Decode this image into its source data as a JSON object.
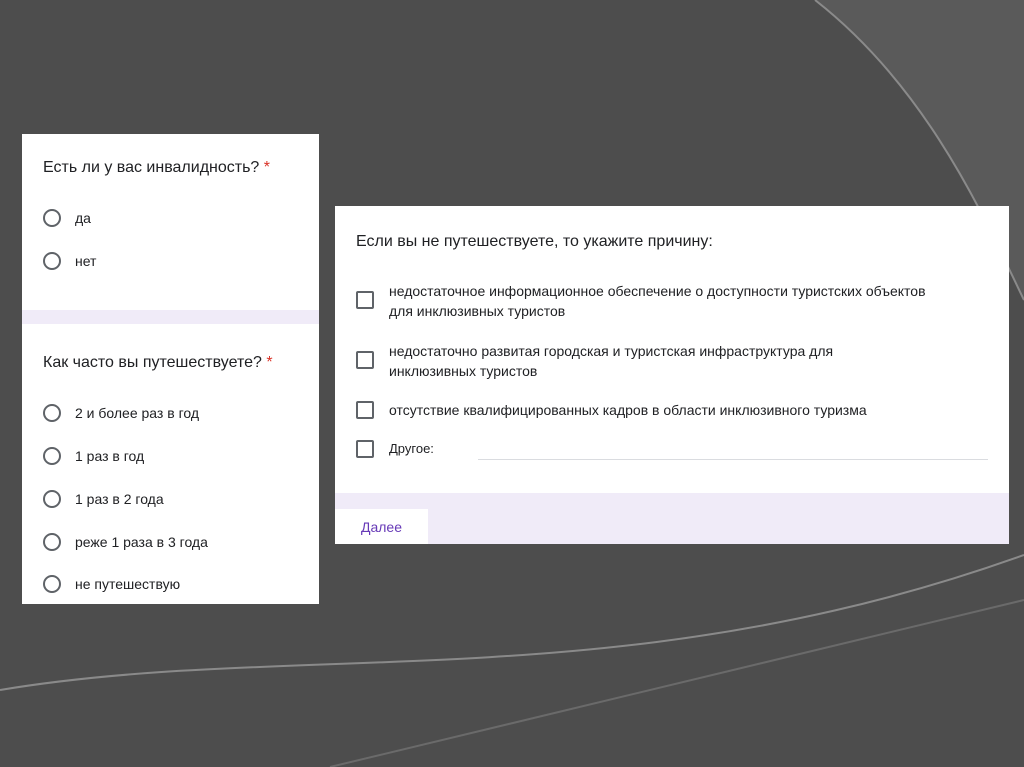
{
  "left_form": {
    "q1": {
      "title": "Есть ли у вас инвалидность?",
      "required_mark": "*",
      "options": [
        "да",
        "нет"
      ]
    },
    "q2": {
      "title": "Как часто вы путешествуете?",
      "required_mark": "*",
      "options": [
        "2 и более раз в год",
        "1 раз в год",
        "1 раз в 2 года",
        "реже 1 раза в 3 года",
        "не путешествую"
      ]
    }
  },
  "right_form": {
    "question": "Если вы не путешествуете, то укажите причину:",
    "options": [
      "недостаточное информационное обеспечение о доступности туристских объектов для инклюзивных туристов",
      "недостаточно развитая городская и туристская инфраструктура для инклюзивных туристов",
      "отсутствие квалифицированных кадров в области инклюзивного туризма"
    ],
    "other_label": "Другое:",
    "next_button": "Далее"
  },
  "colors": {
    "accent": "#673ab7",
    "required": "#d93025",
    "band": "#f0ebf8",
    "background": "#4d4d4d"
  }
}
